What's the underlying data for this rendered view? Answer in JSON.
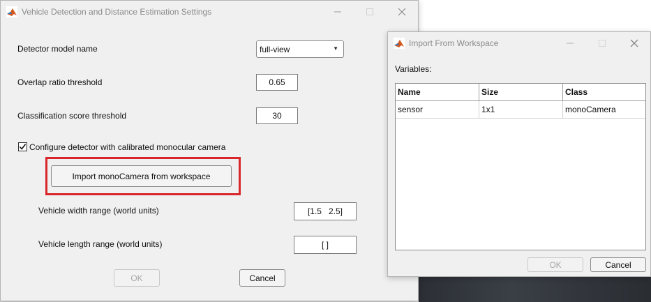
{
  "main_window": {
    "title": "Vehicle Detection and Distance Estimation Settings",
    "detector_model_label": "Detector model name",
    "detector_model_value": "full-view",
    "overlap_label": "Overlap ratio threshold",
    "overlap_value": "0.65",
    "score_label": "Classification score threshold",
    "score_value": "30",
    "configure_checkbox_label": "Configure detector with calibrated monocular camera",
    "configure_checked": true,
    "import_button_label": "Import monoCamera from workspace",
    "width_range_label": "Vehicle width range (world units)",
    "width_range_value": "[1.5   2.5]",
    "length_range_label": "Vehicle length range (world units)",
    "length_range_value": "[ ]",
    "ok_label": "OK",
    "cancel_label": "Cancel"
  },
  "import_window": {
    "title": "Import From Workspace",
    "variables_label": "Variables:",
    "columns": [
      "Name",
      "Size",
      "Class"
    ],
    "rows": [
      [
        "sensor",
        "1x1",
        "monoCamera"
      ]
    ],
    "ok_label": "OK",
    "cancel_label": "Cancel"
  },
  "icons": {
    "app_logo": "matlab-logo-icon",
    "minimize": "minimize-icon",
    "maximize": "maximize-icon",
    "close": "close-icon",
    "dropdown_caret": "caret-down-icon",
    "check": "checkmark-icon"
  },
  "colors": {
    "highlight_border": "#d9262a",
    "window_bg": "#f0f0f0"
  }
}
